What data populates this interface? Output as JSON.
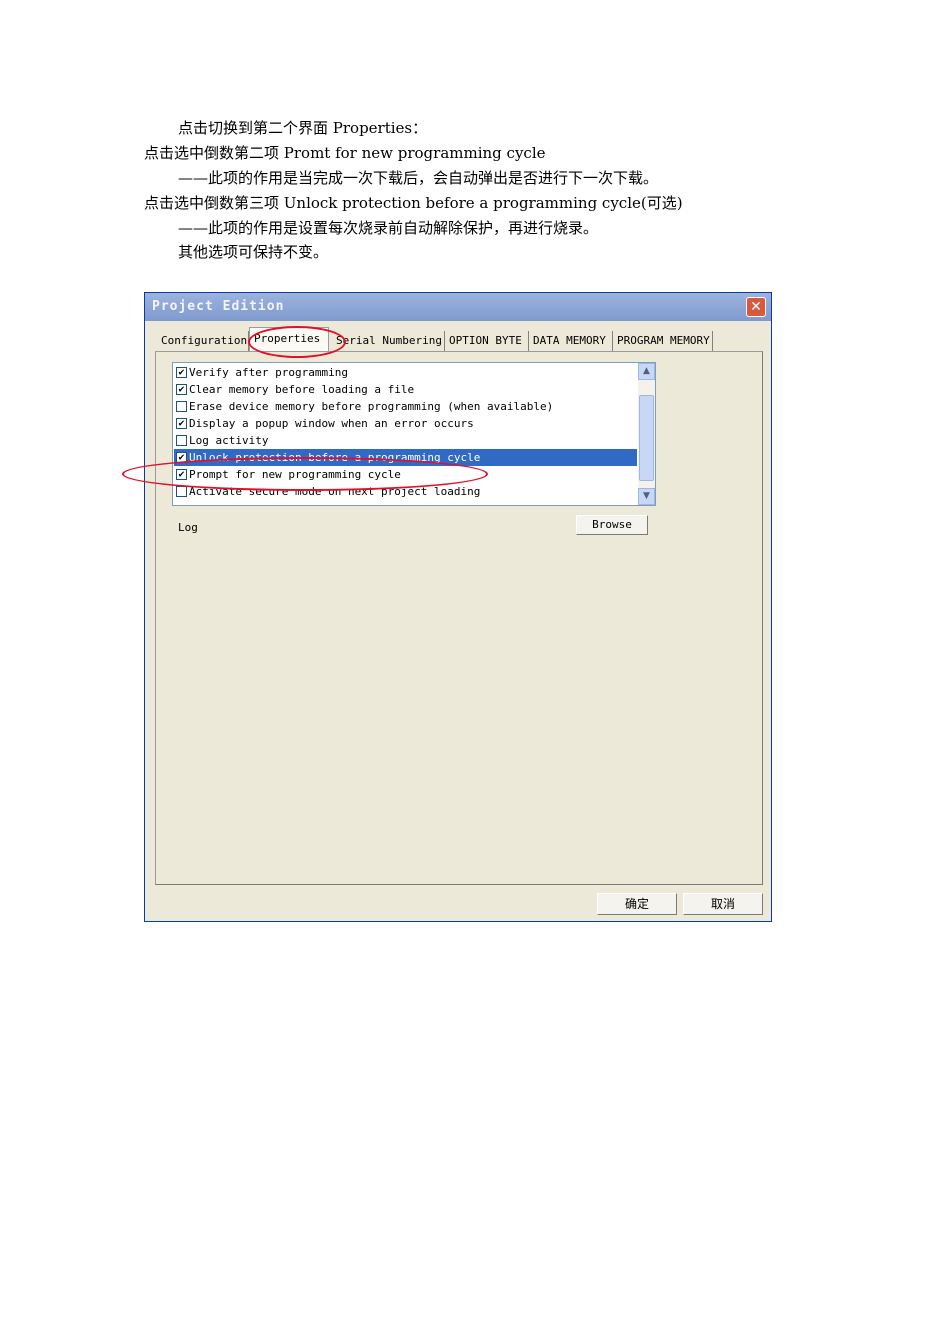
{
  "doc": {
    "lines": [
      "点击切换到第二个界面 Properties：",
      "点击选中倒数第二项 Promt for new programming cycle",
      "——此项的作用是当完成一次下载后，会自动弹出是否进行下一次下载。",
      "点击选中倒数第三项 Unlock protection before a programming cycle(可选)",
      "——此项的作用是设置每次烧录前自动解除保护，再进行烧录。",
      "其他选项可保持不变。"
    ]
  },
  "dialog": {
    "title": "Project Edition",
    "close_label": "✕",
    "tabs": [
      "Configuration",
      "Properties",
      "Serial Numbering",
      "OPTION BYTE",
      "DATA MEMORY",
      "PROGRAM MEMORY"
    ],
    "active_tab": "Properties",
    "options": [
      {
        "label": "Verify after programming",
        "checked": true,
        "selected": false
      },
      {
        "label": "Clear memory before loading a file",
        "checked": true,
        "selected": false
      },
      {
        "label": "Erase device memory before programming (when available)",
        "checked": false,
        "selected": false
      },
      {
        "label": "Display a popup window when an error occurs",
        "checked": true,
        "selected": false
      },
      {
        "label": "Log activity",
        "checked": false,
        "selected": false
      },
      {
        "label": "Unlock protection before a programming cycle",
        "checked": true,
        "selected": true
      },
      {
        "label": "Prompt for new programming cycle",
        "checked": true,
        "selected": false
      },
      {
        "label": "Activate secure mode on next project loading",
        "checked": false,
        "selected": false
      }
    ],
    "log_label": "Log",
    "browse_label": "Browse",
    "ok_label": "确定",
    "cancel_label": "取消"
  },
  "colors": {
    "annotation": "#e0102a",
    "selection": "#316ac5",
    "titlebar": "#8aa4d6"
  }
}
